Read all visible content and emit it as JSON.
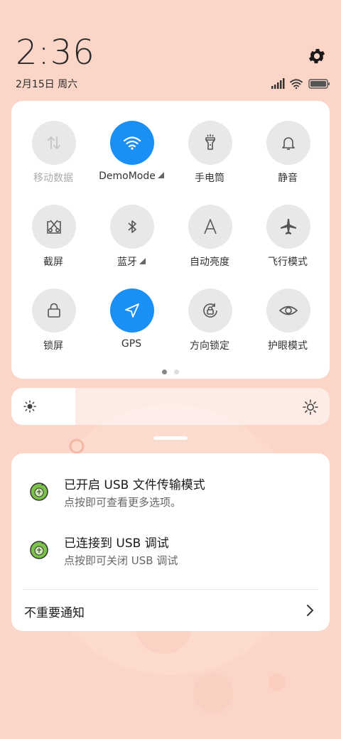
{
  "status": {
    "time": "2:36",
    "date": "2月15日 周六"
  },
  "quick_settings": {
    "tiles": [
      {
        "label": "移动数据",
        "icon": "mobile-data-icon",
        "active": false,
        "dimmed": true,
        "expandable": false
      },
      {
        "label": "DemoMode",
        "icon": "wifi-icon",
        "active": true,
        "dimmed": false,
        "expandable": true
      },
      {
        "label": "手电筒",
        "icon": "flashlight-icon",
        "active": false,
        "dimmed": false,
        "expandable": false
      },
      {
        "label": "静音",
        "icon": "bell-icon",
        "active": false,
        "dimmed": false,
        "expandable": false
      },
      {
        "label": "截屏",
        "icon": "screenshot-icon",
        "active": false,
        "dimmed": false,
        "expandable": false
      },
      {
        "label": "蓝牙",
        "icon": "bluetooth-icon",
        "active": false,
        "dimmed": false,
        "expandable": true
      },
      {
        "label": "自动亮度",
        "icon": "auto-brightness-icon",
        "active": false,
        "dimmed": false,
        "expandable": false
      },
      {
        "label": "飞行模式",
        "icon": "airplane-icon",
        "active": false,
        "dimmed": false,
        "expandable": false
      },
      {
        "label": "锁屏",
        "icon": "lock-icon",
        "active": false,
        "dimmed": false,
        "expandable": false
      },
      {
        "label": "GPS",
        "icon": "location-arrow-icon",
        "active": true,
        "dimmed": false,
        "expandable": false
      },
      {
        "label": "方向锁定",
        "icon": "rotation-lock-icon",
        "active": false,
        "dimmed": false,
        "expandable": false
      },
      {
        "label": "护眼模式",
        "icon": "eye-icon",
        "active": false,
        "dimmed": false,
        "expandable": false
      }
    ],
    "pages": 2,
    "current_page": 1
  },
  "brightness": {
    "level": 0.2
  },
  "notifications": [
    {
      "title": "已开启 USB 文件传输模式",
      "subtitle": "点按即可查看更多选项。",
      "icon": "android-debug-icon"
    },
    {
      "title": "已连接到 USB 调试",
      "subtitle": "点按即可关闭 USB 调试",
      "icon": "android-debug-icon"
    }
  ],
  "unimportant_label": "不重要通知",
  "colors": {
    "background": "#fbd5c8",
    "active_tile": "#1a8ff5",
    "inactive_tile": "#e8e8e8",
    "icon_green": "#7cc24a"
  }
}
